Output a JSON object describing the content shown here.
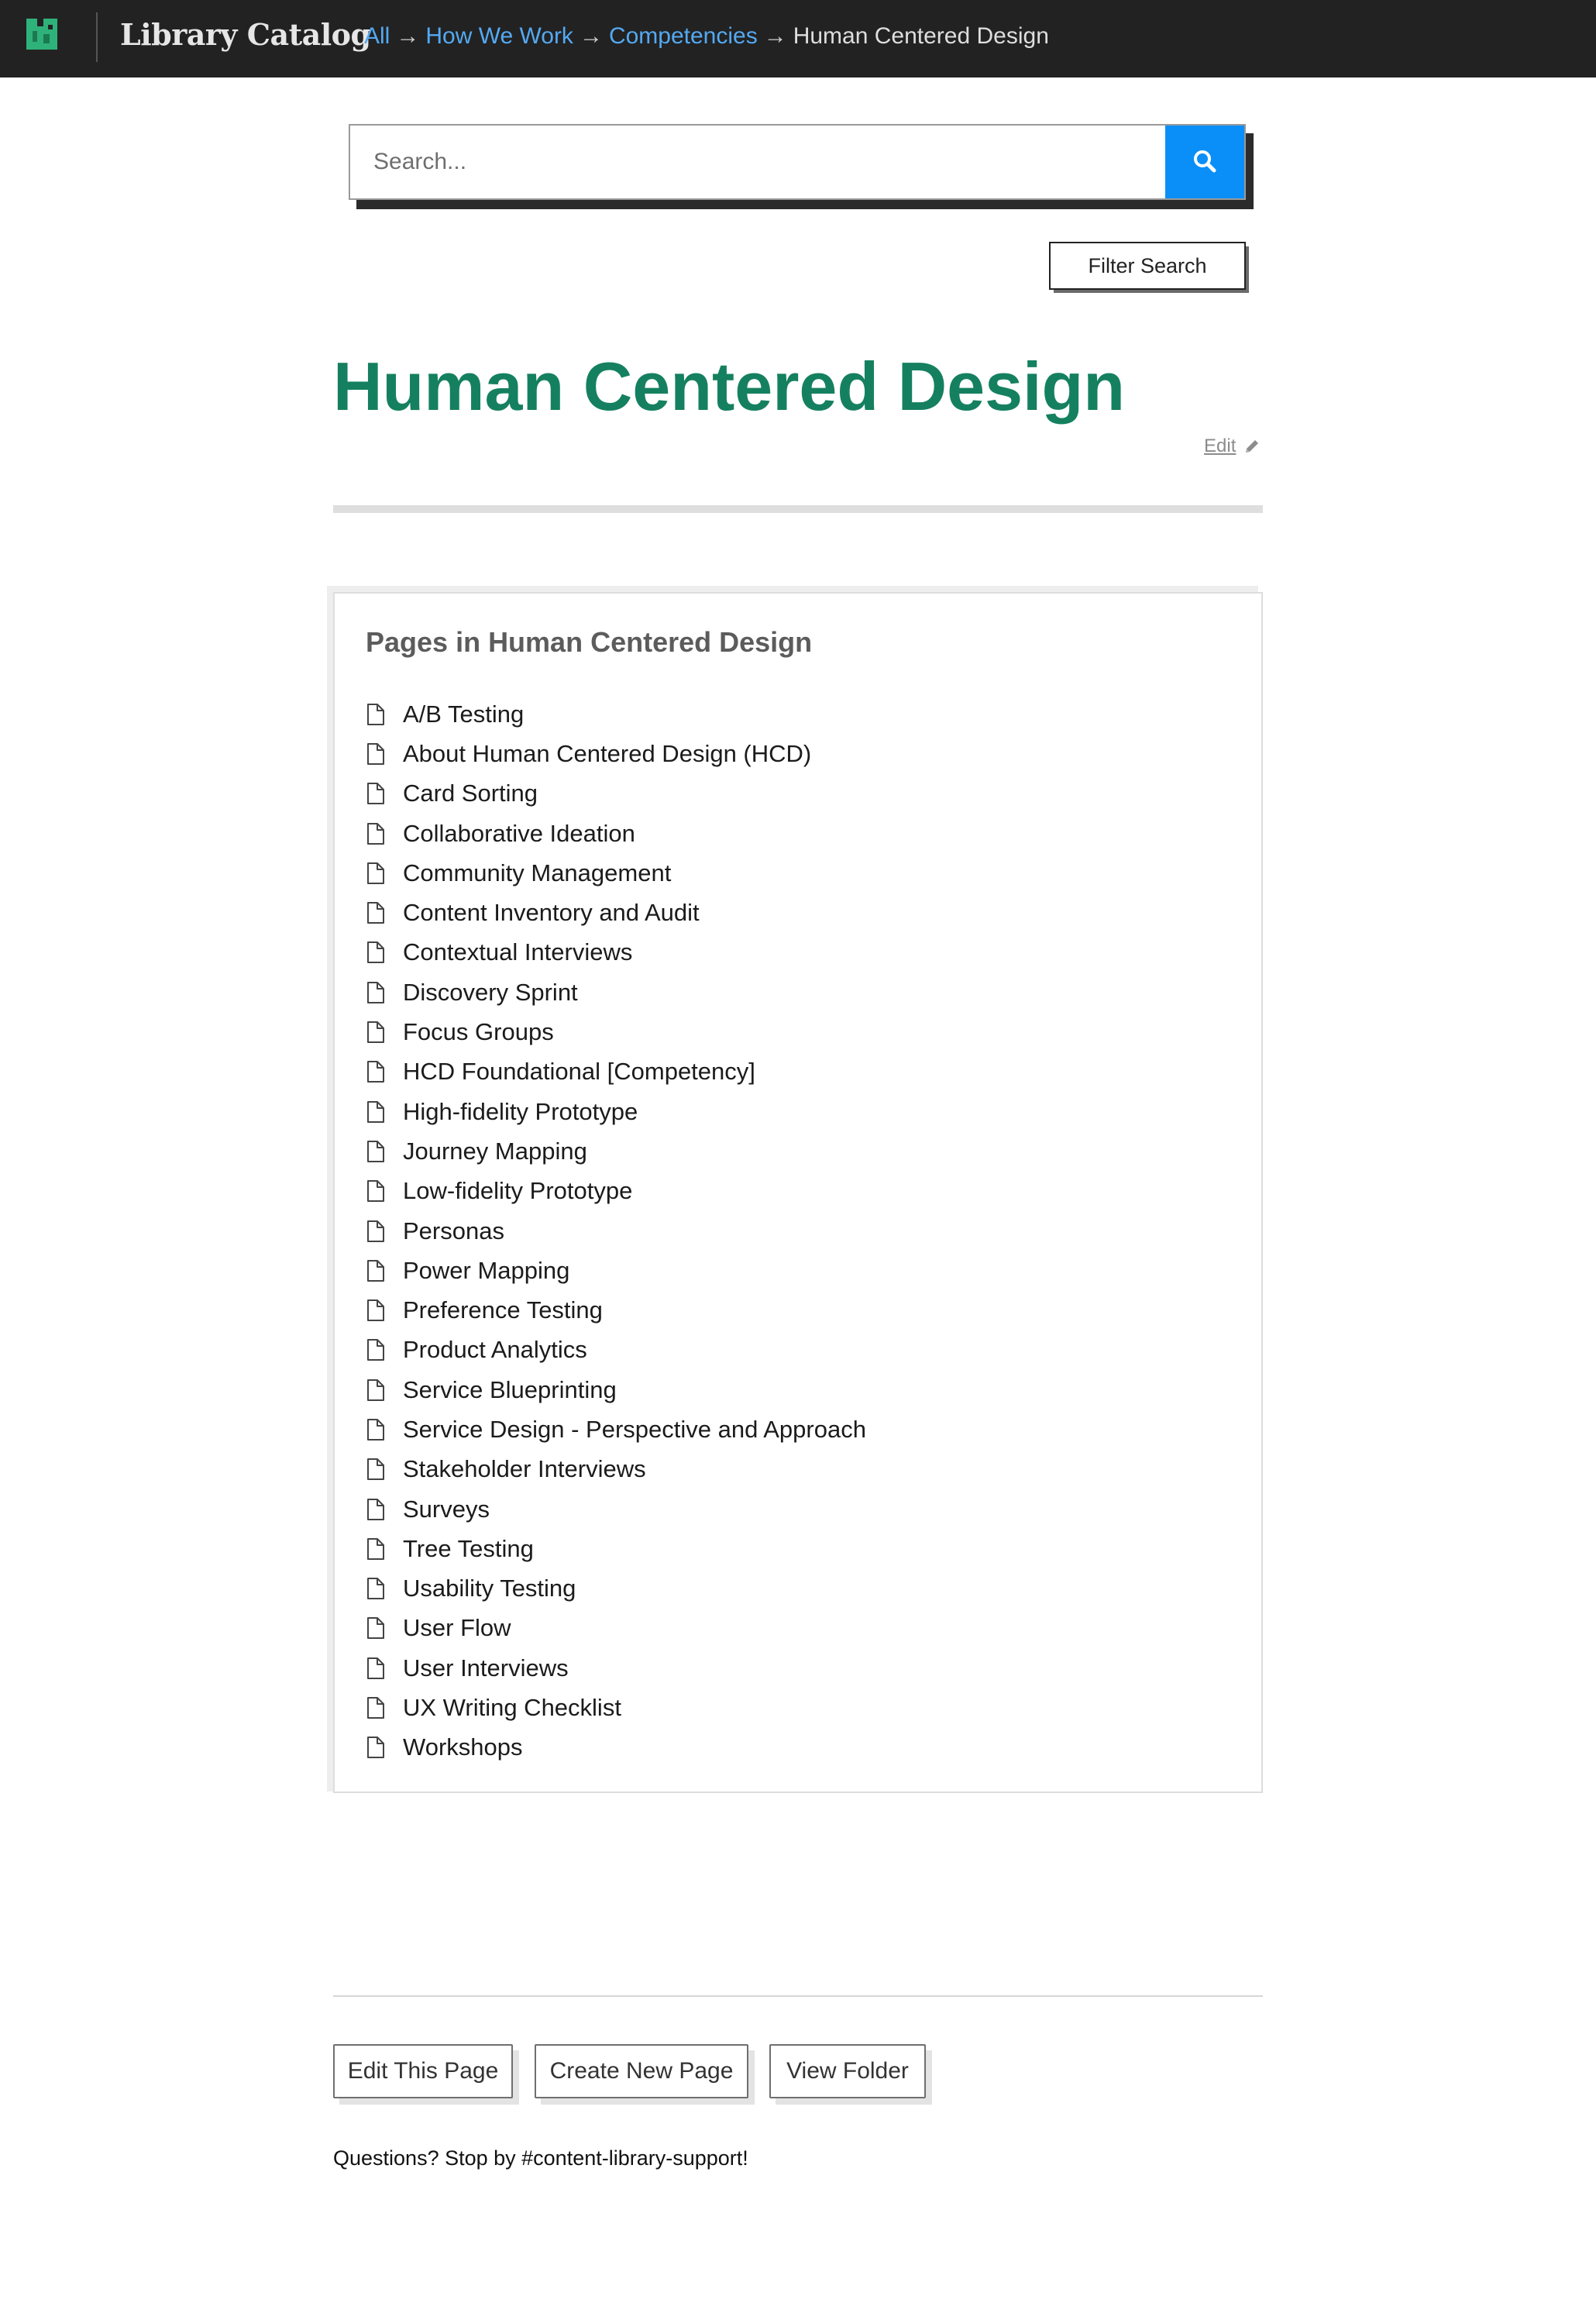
{
  "header": {
    "brand": "Library Catalog",
    "breadcrumbs": [
      {
        "label": "All"
      },
      {
        "label": "How We Work"
      },
      {
        "label": "Competencies"
      }
    ],
    "separator": "→",
    "current": "Human Centered Design",
    "logo_icon": "logo-icon"
  },
  "search": {
    "placeholder": "Search...",
    "value": "",
    "button_icon": "search-icon",
    "filter_label": "Filter Search"
  },
  "page": {
    "title": "Human Centered Design",
    "edit_label": "Edit",
    "edit_icon": "pencil-icon"
  },
  "pages_panel": {
    "heading": "Pages in Human Centered Design",
    "item_icon": "document-icon",
    "items": [
      "A/B Testing",
      "About Human Centered Design (HCD)",
      "Card Sorting",
      "Collaborative Ideation",
      "Community Management",
      "Content Inventory and Audit",
      "Contextual Interviews",
      "Discovery Sprint",
      "Focus Groups",
      "HCD Foundational [Competency]",
      "High-fidelity Prototype",
      "Journey Mapping",
      "Low-fidelity Prototype",
      "Personas",
      "Power Mapping",
      "Preference Testing",
      "Product Analytics",
      "Service Blueprinting",
      "Service Design - Perspective and Approach",
      "Stakeholder Interviews",
      "Surveys",
      "Tree Testing",
      "Usability Testing",
      "User Flow",
      "User Interviews",
      "UX Writing Checklist",
      "Workshops"
    ]
  },
  "footer": {
    "edit_page": "Edit This Page",
    "create_page": "Create New Page",
    "view_folder": "View Folder",
    "help": "Questions? Stop by #content-library-support!"
  },
  "colors": {
    "topbar_bg": "#222222",
    "link": "#54a9f2",
    "title_green": "#15805f",
    "search_button": "#0a8ff8"
  }
}
